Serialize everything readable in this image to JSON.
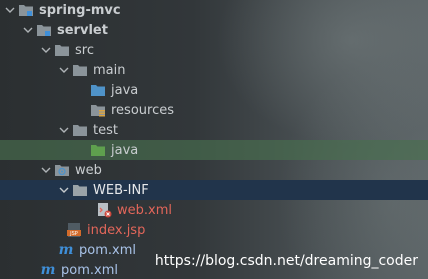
{
  "tree": {
    "items": [
      {
        "label": "spring-mvc",
        "icon": "module-folder-icon"
      },
      {
        "label": "servlet",
        "icon": "module-folder-icon"
      },
      {
        "label": "src",
        "icon": "folder-icon"
      },
      {
        "label": "main",
        "icon": "folder-icon"
      },
      {
        "label": "java",
        "icon": "source-folder-icon"
      },
      {
        "label": "resources",
        "icon": "resources-folder-icon"
      },
      {
        "label": "test",
        "icon": "folder-icon"
      },
      {
        "label": "java",
        "icon": "test-source-folder-icon"
      },
      {
        "label": "web",
        "icon": "web-folder-icon"
      },
      {
        "label": "WEB-INF",
        "icon": "folder-icon"
      },
      {
        "label": "web.xml",
        "icon": "xml-file-icon"
      },
      {
        "label": "index.jsp",
        "icon": "jsp-file-icon"
      },
      {
        "label": "pom.xml",
        "icon": "maven-file-icon"
      },
      {
        "label": "pom.xml",
        "icon": "maven-file-icon"
      }
    ]
  },
  "watermark": {
    "text": "https://blog.csdn.net/dreaming_coder"
  },
  "colors": {
    "folder": "#8b949a",
    "source_folder": "#4f93c9",
    "test_folder": "#5fa04e",
    "highlight_green": "#486e4e",
    "highlight_blue": "#21344b",
    "error_text": "#e2665a"
  }
}
